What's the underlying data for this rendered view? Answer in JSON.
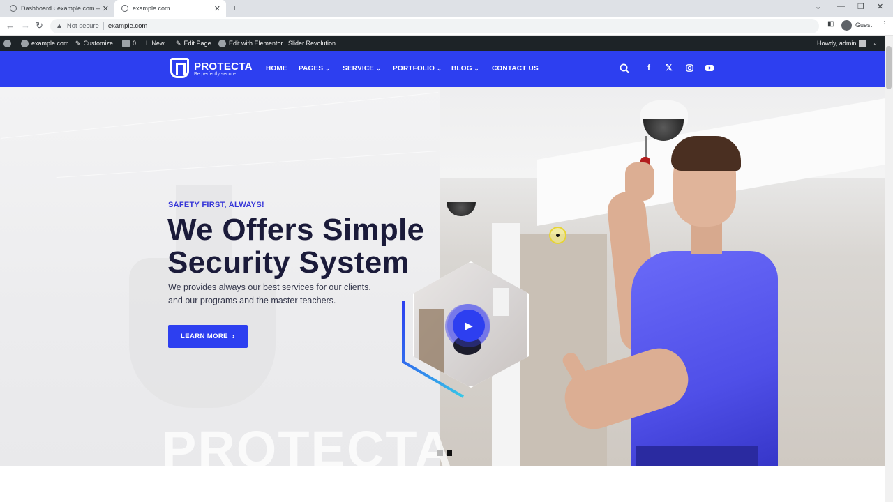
{
  "browser": {
    "tabs": [
      {
        "title": "Dashboard ‹ example.com — W",
        "active": false
      },
      {
        "title": "example.com",
        "active": true
      }
    ],
    "omnibox": {
      "security": "Not secure",
      "url": "example.com"
    },
    "profile": "Guest"
  },
  "adminbar": {
    "site": "example.com",
    "customize": "Customize",
    "comments": "0",
    "new": "New",
    "edit_page": "Edit Page",
    "edit_elementor": "Edit with Elementor",
    "slider": "Slider Revolution",
    "howdy": "Howdy, admin"
  },
  "header": {
    "logo": {
      "name": "PROTECTA",
      "tagline": "Be perfectly secure"
    },
    "nav": [
      {
        "label": "HOME",
        "dropdown": false
      },
      {
        "label": "PAGES",
        "dropdown": true
      },
      {
        "label": "SERVICE",
        "dropdown": true
      },
      {
        "label": "PORTFOLIO",
        "dropdown": true
      },
      {
        "label": "BLOG",
        "dropdown": true
      },
      {
        "label": "CONTACT US",
        "dropdown": false
      }
    ],
    "icons": [
      "search-icon",
      "facebook-icon",
      "x-icon",
      "instagram-icon",
      "youtube-icon"
    ]
  },
  "hero": {
    "eyebrow": "SAFETY FIRST, ALWAYS!",
    "headline_line1": "We Offers Simple",
    "headline_line2": "Security System",
    "sub_line1": "We provides always our best services for our clients.",
    "sub_line2": "and our programs and the master teachers.",
    "cta": "LEARN MORE",
    "watermark": "PROTECTA",
    "slides": {
      "count": 2,
      "active": 2
    }
  },
  "colors": {
    "brand": "#2d3ff0",
    "headline": "#1b1b3a",
    "adminbar": "#1d2327"
  }
}
